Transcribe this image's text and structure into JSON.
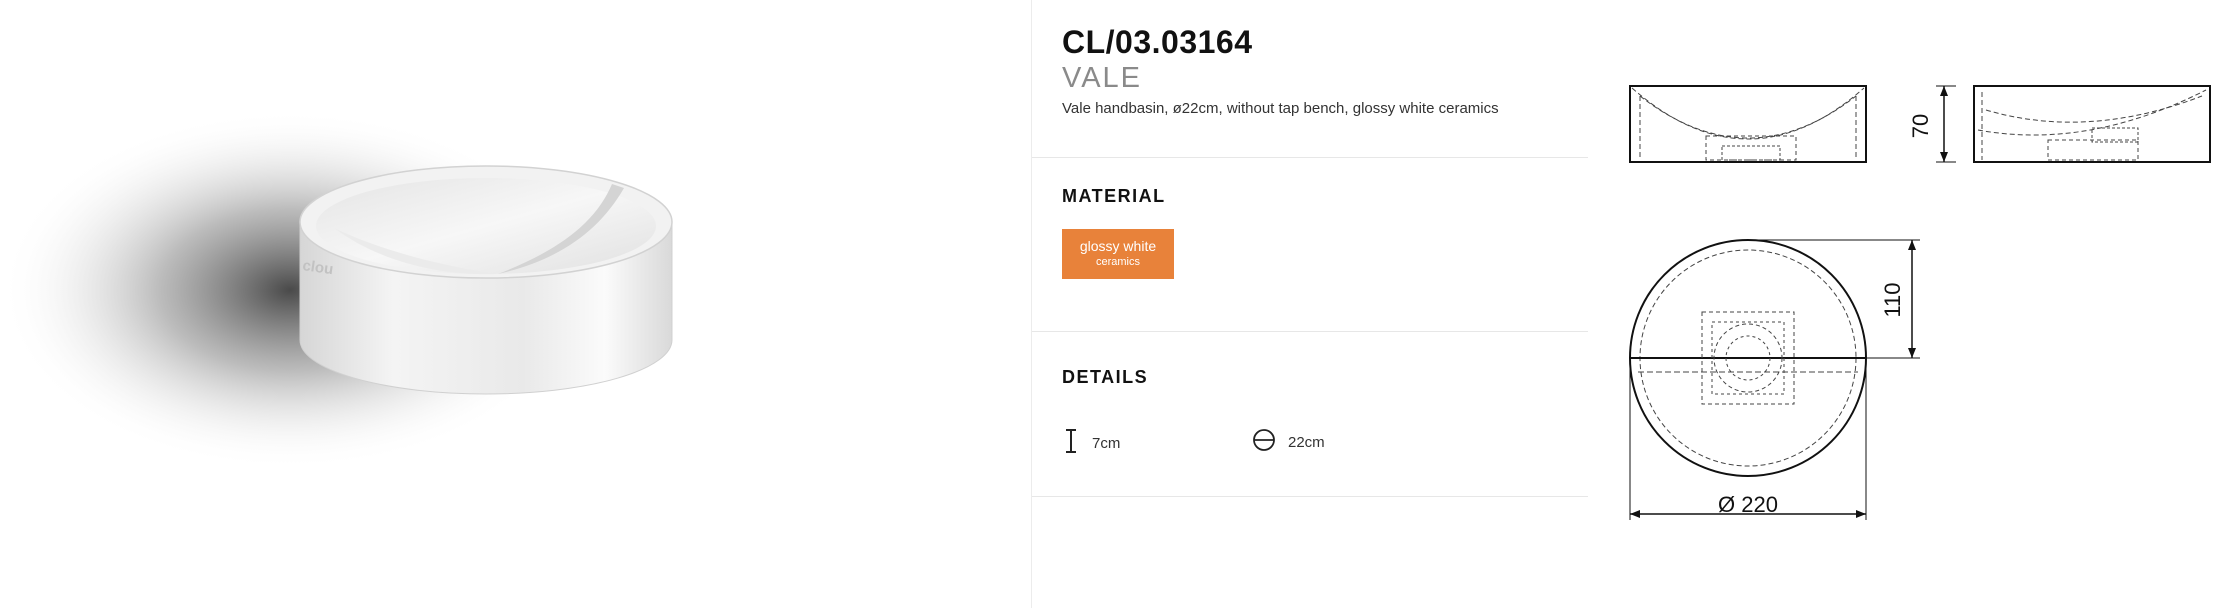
{
  "product": {
    "code": "CL/03.03164",
    "name": "VALE",
    "description": "Vale handbasin, ø22cm, without tap bench, glossy white ceramics",
    "brand_mark": "clou"
  },
  "material": {
    "title": "MATERIAL",
    "swatch_line1": "glossy white",
    "swatch_line2": "ceramics",
    "swatch_color": "#e8823a"
  },
  "details": {
    "title": "DETAILS",
    "height": {
      "icon": "height-icon",
      "value": "7cm"
    },
    "diameter": {
      "icon": "diameter-icon",
      "value": "22cm"
    }
  },
  "drawings": {
    "height_dim": "70",
    "radius_dim": "110",
    "diameter_dim": "Ø 220"
  }
}
